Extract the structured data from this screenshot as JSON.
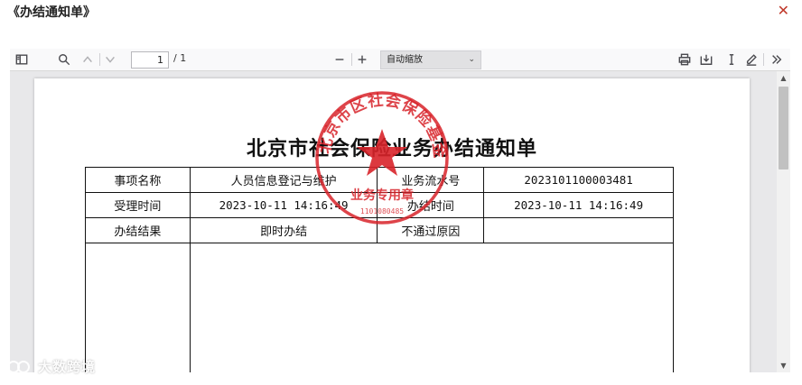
{
  "dialog": {
    "title": "《办结通知单》",
    "close_icon": "close-icon"
  },
  "toolbar": {
    "icons": {
      "sidebar": "sidebar-toggle-icon",
      "find": "search-icon",
      "prev": "chevron-up-icon",
      "next": "chevron-down-icon",
      "zoom_out": "minus-icon",
      "zoom_in": "plus-icon",
      "print": "print-icon",
      "download": "download-icon",
      "text_select": "text-cursor-icon",
      "draw": "pen-icon",
      "more": "double-chevron-right-icon"
    },
    "page_number": "1",
    "page_total": "/ 1",
    "zoom_value": "自动缩放"
  },
  "document": {
    "title": "北京市社会保险业务办结通知单",
    "rows": [
      {
        "label1": "事项名称",
        "value1": "人员信息登记与维护",
        "label2": "业务流水号",
        "value2": "2023101100003481"
      },
      {
        "label1": "受理时间",
        "value1": "2023-10-11 14:16:49",
        "label2": "办结时间",
        "value2": "2023-10-11 14:16:49"
      },
      {
        "label1": "办结结果",
        "value1": "即时办结",
        "label2": "不通过原因",
        "value2": ""
      }
    ],
    "seal": {
      "ring_text": "北京市区社会保险基金管理中心",
      "center_text": "业务专用章",
      "number": "1101080485",
      "color": "#d8232a"
    }
  },
  "watermark": {
    "text": "大数跨境"
  }
}
